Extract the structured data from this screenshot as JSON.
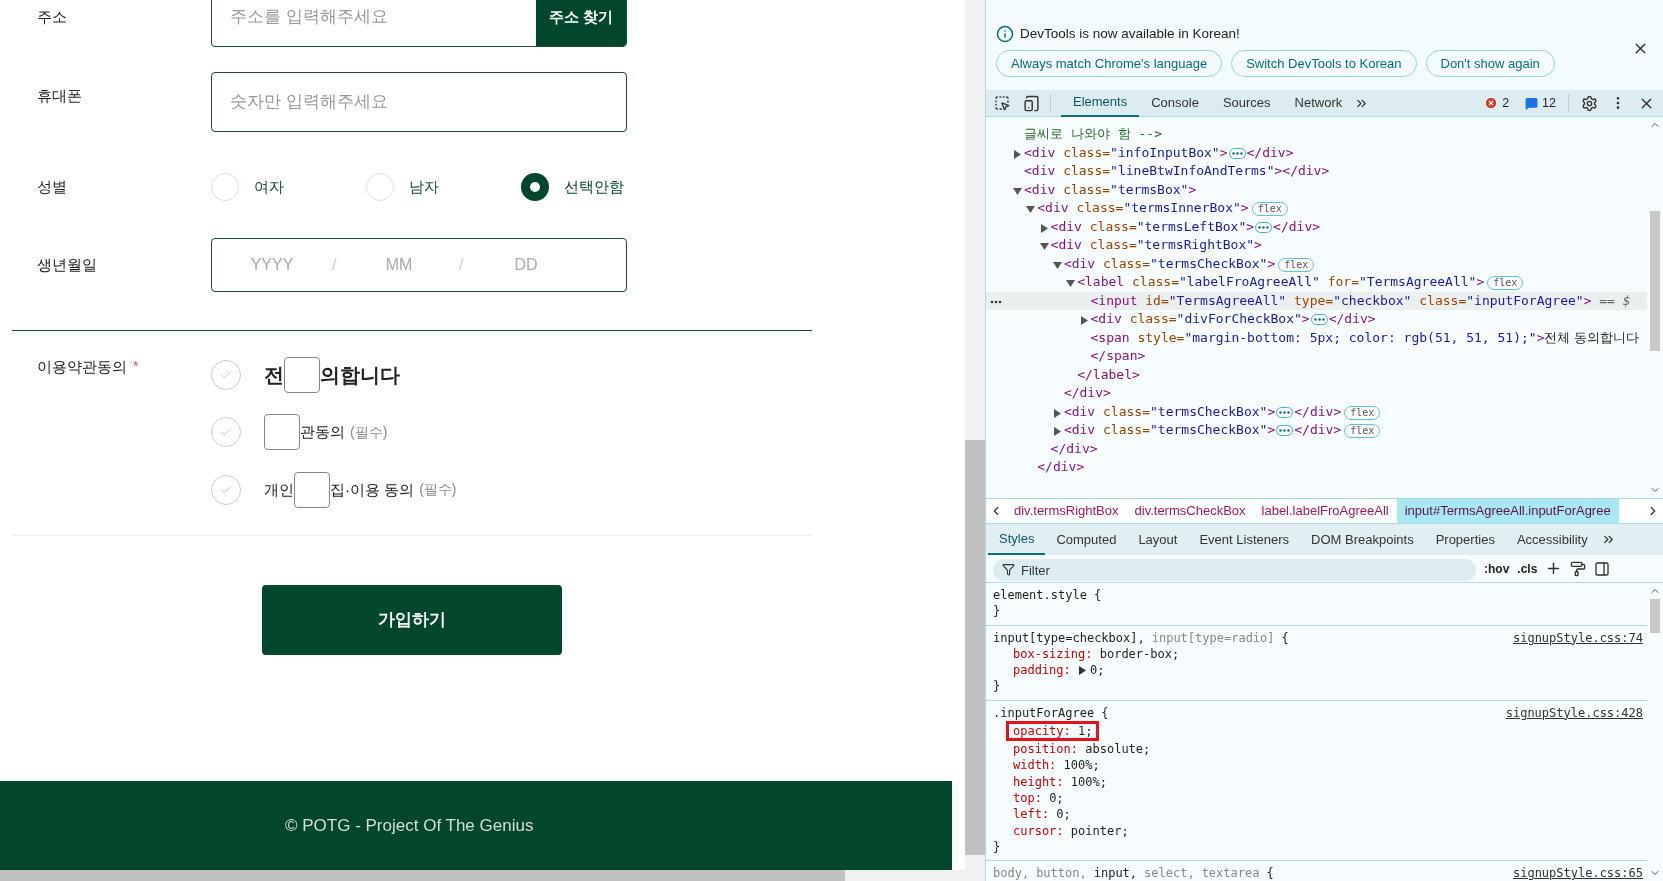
{
  "form": {
    "address": {
      "label": "주소",
      "placeholder": "주소를 입력해주세요",
      "button": "주소 찾기"
    },
    "phone": {
      "label": "휴대폰",
      "placeholder": "숫자만 입력해주세요"
    },
    "gender": {
      "label": "성별",
      "options": [
        {
          "label": "여자",
          "selected": false
        },
        {
          "label": "남자",
          "selected": false
        },
        {
          "label": "선택안함",
          "selected": true
        }
      ]
    },
    "birth": {
      "label": "생년월일",
      "fields": [
        {
          "placeholder": "YYYY"
        },
        {
          "placeholder": "MM"
        },
        {
          "placeholder": "DD"
        }
      ],
      "separators": [
        "/",
        "/"
      ]
    },
    "terms": {
      "label": "이용약관동의",
      "required_mark": "*",
      "items": [
        {
          "kind": "all",
          "text_before": "전",
          "text_after": "의합니다",
          "checked": false
        },
        {
          "kind": "required",
          "text_after": "관동의",
          "note": "(필수)",
          "checked": false
        },
        {
          "kind": "required",
          "text_before": "개인",
          "text_after": "집·이용 동의",
          "note": "(필수)",
          "checked": false
        }
      ]
    },
    "submit": "가입하기"
  },
  "footer": "© POTG - Project Of The Genius",
  "devtools": {
    "banner": {
      "message": "DevTools is now available in Korean!",
      "buttons": [
        "Always match Chrome's language",
        "Switch DevTools to Korean",
        "Don't show again"
      ]
    },
    "tabs": [
      {
        "label": "Elements",
        "selected": true
      },
      {
        "label": "Console",
        "selected": false
      },
      {
        "label": "Sources",
        "selected": false
      },
      {
        "label": "Network",
        "selected": false
      }
    ],
    "error_count": "2",
    "message_count": "12",
    "dom": [
      {
        "kind": "comment",
        "text": "글씨로 나와야 함 -->"
      },
      {
        "kind": "element",
        "open": "<div class=\"infoInputBox\">",
        "expanded": false,
        "ellipsis": true,
        "close": "</div>"
      },
      {
        "kind": "element",
        "open": "<div class=\"lineBtwInfoAndTerms\">",
        "close": "</div>"
      },
      {
        "kind": "element",
        "open": "<div class=\"termsBox\">",
        "expanded": true,
        "children": [
          {
            "kind": "element",
            "open": "<div class=\"termsInnerBox\">",
            "badge": "flex",
            "expanded": true,
            "closing": "</div>",
            "children": [
              {
                "kind": "element",
                "open": "<div class=\"termsLeftBox\">",
                "expanded": false,
                "ellipsis": true,
                "close": "</div>"
              },
              {
                "kind": "element",
                "open": "<div class=\"termsRightBox\">",
                "expanded": true,
                "closing": "</div>",
                "children": [
                  {
                    "kind": "element",
                    "open": "<div class=\"termsCheckBox\">",
                    "badge": "flex",
                    "expanded": true,
                    "closing": "</div>",
                    "children": [
                      {
                        "kind": "element",
                        "open": "<label class=\"labelFroAgreeAll\" for=\"TermsAgreeAll\">",
                        "badge": "flex",
                        "expanded": true,
                        "closing": "</label>",
                        "children": [
                          {
                            "kind": "element",
                            "open": "<input id=\"TermsAgreeAll\" type=\"checkbox\" class=\"inputForAgree\">",
                            "selected": true,
                            "suffix": "== $"
                          },
                          {
                            "kind": "element",
                            "open": "<div class=\"divForCheckBox\">",
                            "expanded": false,
                            "ellipsis": true,
                            "close": "</div>"
                          },
                          {
                            "kind": "element",
                            "open": "<span style=\"margin-bottom: 5px; color: rgb(51, 51, 51);\">",
                            "text": "전체 동의합니다",
                            "close": "</span>"
                          }
                        ]
                      }
                    ]
                  },
                  {
                    "kind": "element",
                    "open": "<div class=\"termsCheckBox\">",
                    "expanded": false,
                    "ellipsis": true,
                    "close": "</div>",
                    "badge": "flex"
                  },
                  {
                    "kind": "element",
                    "open": "<div class=\"termsCheckBox\">",
                    "expanded": false,
                    "ellipsis": true,
                    "close": "</div>",
                    "badge": "flex"
                  }
                ]
              }
            ]
          }
        ]
      }
    ],
    "breadcrumbs": [
      {
        "text": "div.termsRightBox",
        "selected": false
      },
      {
        "text": "div.termsCheckBox",
        "selected": false
      },
      {
        "text": "label.labelFroAgreeAll",
        "selected": false
      },
      {
        "text": "input#TermsAgreeAll.inputForAgree",
        "selected": true
      }
    ],
    "style_tabs": [
      {
        "label": "Styles",
        "selected": true
      },
      {
        "label": "Computed",
        "selected": false
      },
      {
        "label": "Layout",
        "selected": false
      },
      {
        "label": "Event Listeners",
        "selected": false
      },
      {
        "label": "DOM Breakpoints",
        "selected": false
      },
      {
        "label": "Properties",
        "selected": false
      },
      {
        "label": "Accessibility",
        "selected": false
      }
    ],
    "filter_placeholder": "Filter",
    "style_tools": [
      ":hov",
      ".cls"
    ],
    "rules": [
      {
        "selector": [
          {
            "text": "element.style",
            "matched": true
          }
        ],
        "open": "{",
        "close": "}"
      },
      {
        "selector": [
          {
            "text": "input[type=checkbox],",
            "matched": true
          },
          {
            "text": "input[type=radio]",
            "matched": false
          }
        ],
        "open": "{",
        "close": "}",
        "source": "signupStyle.css:74",
        "props": [
          {
            "name": "box-sizing:",
            "value": "border-box;"
          },
          {
            "name": "padding:",
            "value": "0;",
            "shorthand": true
          }
        ]
      },
      {
        "selector": [
          {
            "text": ".inputForAgree",
            "matched": true
          }
        ],
        "open": "{",
        "close": "}",
        "source": "signupStyle.css:428",
        "props": [
          {
            "name": "opacity:",
            "value": "1;",
            "highlighted": true
          },
          {
            "name": "position:",
            "value": "absolute;"
          },
          {
            "name": "width:",
            "value": "100%;"
          },
          {
            "name": "height:",
            "value": "100%;"
          },
          {
            "name": "top:",
            "value": "0;"
          },
          {
            "name": "left:",
            "value": "0;"
          },
          {
            "name": "cursor:",
            "value": "pointer;"
          }
        ]
      },
      {
        "selector": [
          {
            "text": "body,",
            "matched": false
          },
          {
            "text": "button,",
            "matched": false
          },
          {
            "text": "input,",
            "matched": true
          },
          {
            "text": "select,",
            "matched": false
          },
          {
            "text": "textarea",
            "matched": false
          }
        ],
        "open": "{",
        "source": "signupStyle.css:65"
      }
    ]
  }
}
